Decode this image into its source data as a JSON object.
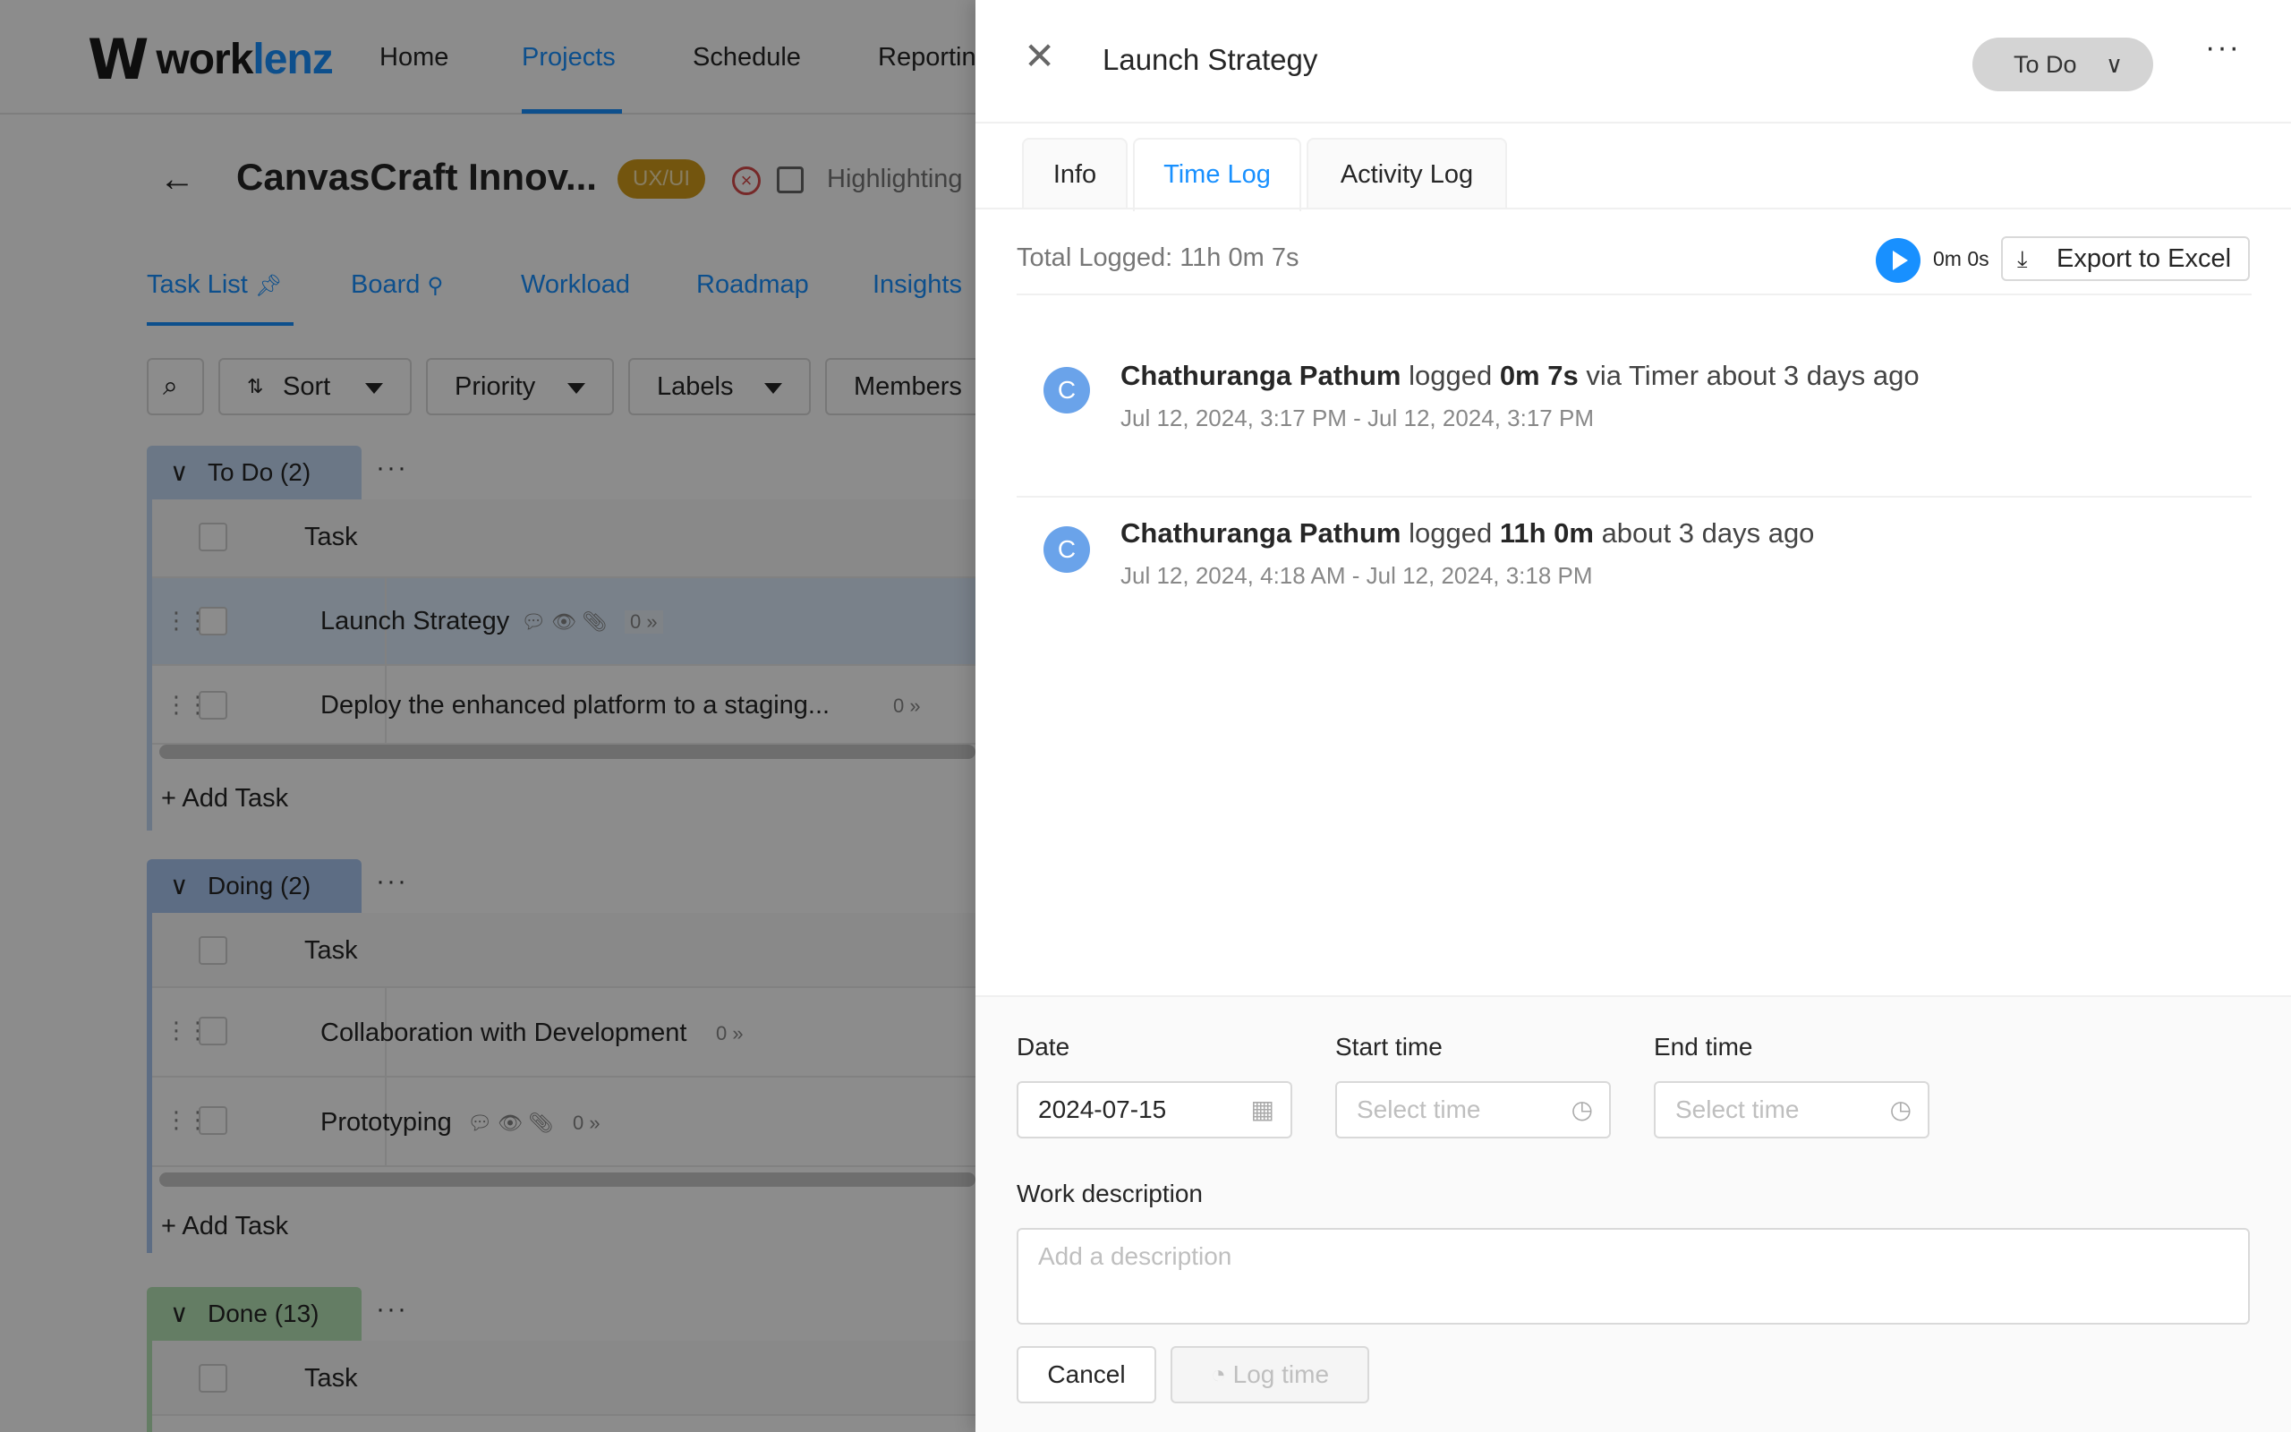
{
  "header": {
    "logo_mark": "W",
    "logo_text_a": "work",
    "logo_text_b": "lenz",
    "nav": [
      "Home",
      "Projects",
      "Schedule",
      "Reporting"
    ]
  },
  "project": {
    "title": "CanvasCraft Innov...",
    "tag": "UX/UI",
    "highlight": "Highlighting",
    "tabs": [
      "Task List",
      "Board",
      "Workload",
      "Roadmap",
      "Insights"
    ],
    "filters": [
      "Sort",
      "Priority",
      "Labels",
      "Members"
    ]
  },
  "groups": [
    {
      "name": "To Do (2)",
      "color": "#c3d9f5",
      "col": "Task",
      "tasks": [
        {
          "name": "Launch Strategy",
          "count": "0"
        },
        {
          "name": "Deploy the enhanced platform to a staging...",
          "count": "0"
        }
      ],
      "add": "+ Add Task"
    },
    {
      "name": "Doing (2)",
      "color": "#a9c7f0",
      "col": "Task",
      "tasks": [
        {
          "name": "Collaboration with Development",
          "count": "0"
        },
        {
          "name": "Prototyping",
          "count": "0"
        }
      ],
      "add": "+ Add Task"
    },
    {
      "name": "Done (13)",
      "color": "#b6e3b6",
      "col": "Task",
      "tasks": [],
      "add": ""
    }
  ],
  "drawer": {
    "title": "Launch Strategy",
    "status": "To Do",
    "tabs": [
      "Info",
      "Time Log",
      "Activity Log"
    ],
    "total_logged": "Total Logged: 11h 0m 7s",
    "timer": "0m 0s",
    "export": "Export to Excel",
    "entries": [
      {
        "initial": "C",
        "user": "Chathuranga Pathum",
        "verb": "logged",
        "duration": "0m 7s",
        "tail": "via Timer about 3 days ago",
        "range": "Jul 12, 2024, 3:17 PM - Jul 12, 2024, 3:17 PM"
      },
      {
        "initial": "C",
        "user": "Chathuranga Pathum",
        "verb": "logged",
        "duration": "11h 0m",
        "tail": "about 3 days ago",
        "range": "Jul 12, 2024, 4:18 AM - Jul 12, 2024, 3:18 PM"
      }
    ],
    "form": {
      "date_label": "Date",
      "date_value": "2024-07-15",
      "start_label": "Start time",
      "start_placeholder": "Select time",
      "end_label": "End time",
      "end_placeholder": "Select time",
      "desc_label": "Work description",
      "desc_placeholder": "Add a description",
      "cancel": "Cancel",
      "submit": "Log time"
    }
  },
  "colors": {
    "accent": "#1890ff",
    "tag": "#d19c1a",
    "avatar": "#6aa3ea"
  }
}
